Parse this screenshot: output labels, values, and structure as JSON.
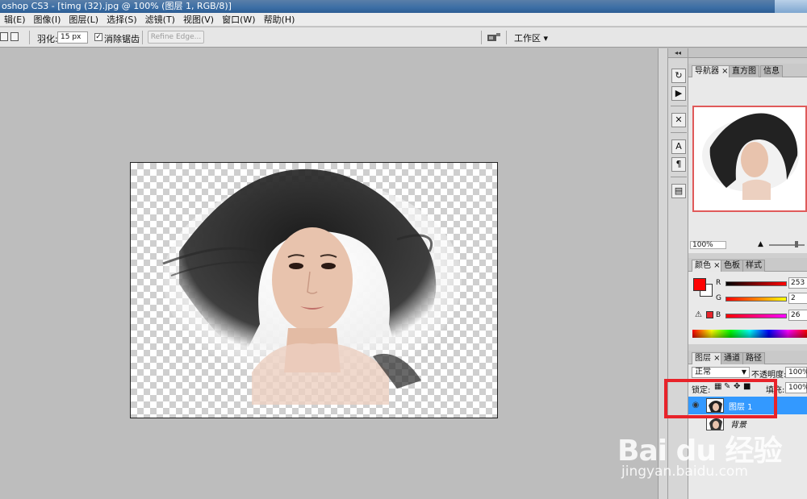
{
  "window": {
    "title": "oshop CS3 - [timg (32).jpg @ 100% (图层 1, RGB/8)]"
  },
  "menu": [
    "辑(E)",
    "图像(I)",
    "图层(L)",
    "选择(S)",
    "滤镜(T)",
    "视图(V)",
    "窗口(W)",
    "帮助(H)"
  ],
  "options": {
    "feather_label": "羽化:",
    "feather_value": "15 px",
    "antialias_label": "消除锯齿",
    "refine_edge": "Refine Edge...",
    "workspace": "工作区 ▾"
  },
  "panels": {
    "navigator_tabs": [
      "导航器",
      "直方图",
      "信息"
    ],
    "navigator_zoom": "100%",
    "color_tabs": [
      "颜色",
      "色板",
      "样式"
    ],
    "color": {
      "R": "253",
      "G": "2",
      "B": "26"
    },
    "layers_tabs": [
      "图层",
      "通道",
      "路径"
    ],
    "blend_mode": "正常",
    "opacity_label": "不透明度:",
    "opacity_value": "100%",
    "lock_label": "锁定:",
    "fill_label": "填充:",
    "fill_value": "100%",
    "layers": [
      {
        "name": "图层 1",
        "selected": true
      },
      {
        "name": "背景",
        "selected": false
      }
    ]
  },
  "colors": {
    "highlight": "#e8232a",
    "selection": "#3399ff",
    "foreground": "#fd0202"
  },
  "watermark": {
    "logo": "Bai du 经验",
    "url": "jingyan.baidu.com"
  }
}
